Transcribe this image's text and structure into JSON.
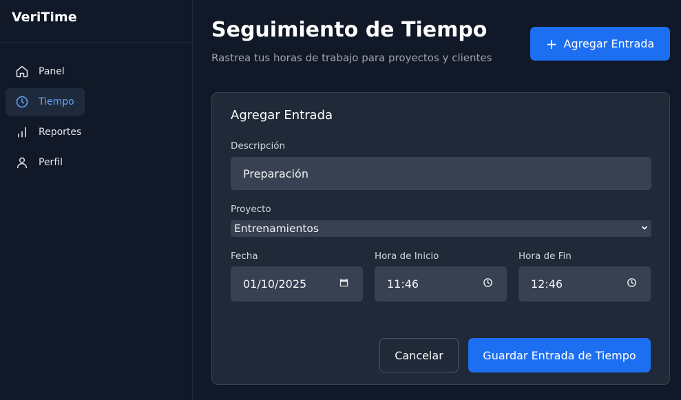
{
  "app": {
    "name": "VeriTime"
  },
  "sidebar": {
    "items": [
      {
        "label": "Panel",
        "icon": "home-icon",
        "active": false
      },
      {
        "label": "Tiempo",
        "icon": "clock-icon",
        "active": true
      },
      {
        "label": "Reportes",
        "icon": "bar-chart-icon",
        "active": false
      },
      {
        "label": "Perfil",
        "icon": "user-icon",
        "active": false
      }
    ]
  },
  "header": {
    "title": "Seguimiento de Tiempo",
    "subtitle": "Rastrea tus horas de trabajo para proyectos y clientes",
    "add_button_label": "Agregar Entrada"
  },
  "form": {
    "title": "Agregar Entrada",
    "description_label": "Descripción",
    "description_value": "Preparación",
    "project_label": "Proyecto",
    "project_value": "Entrenamientos",
    "date_label": "Fecha",
    "date_value": "01/10/2025",
    "start_label": "Hora de Inicio",
    "start_value": "11:46",
    "end_label": "Hora de Fin",
    "end_value": "12:46",
    "cancel_label": "Cancelar",
    "save_label": "Guardar Entrada de Tiempo"
  },
  "colors": {
    "background": "#111827",
    "card": "#1f2937",
    "input": "#374151",
    "accent": "#1d6ff2",
    "active_nav_text": "#60a5fa"
  }
}
